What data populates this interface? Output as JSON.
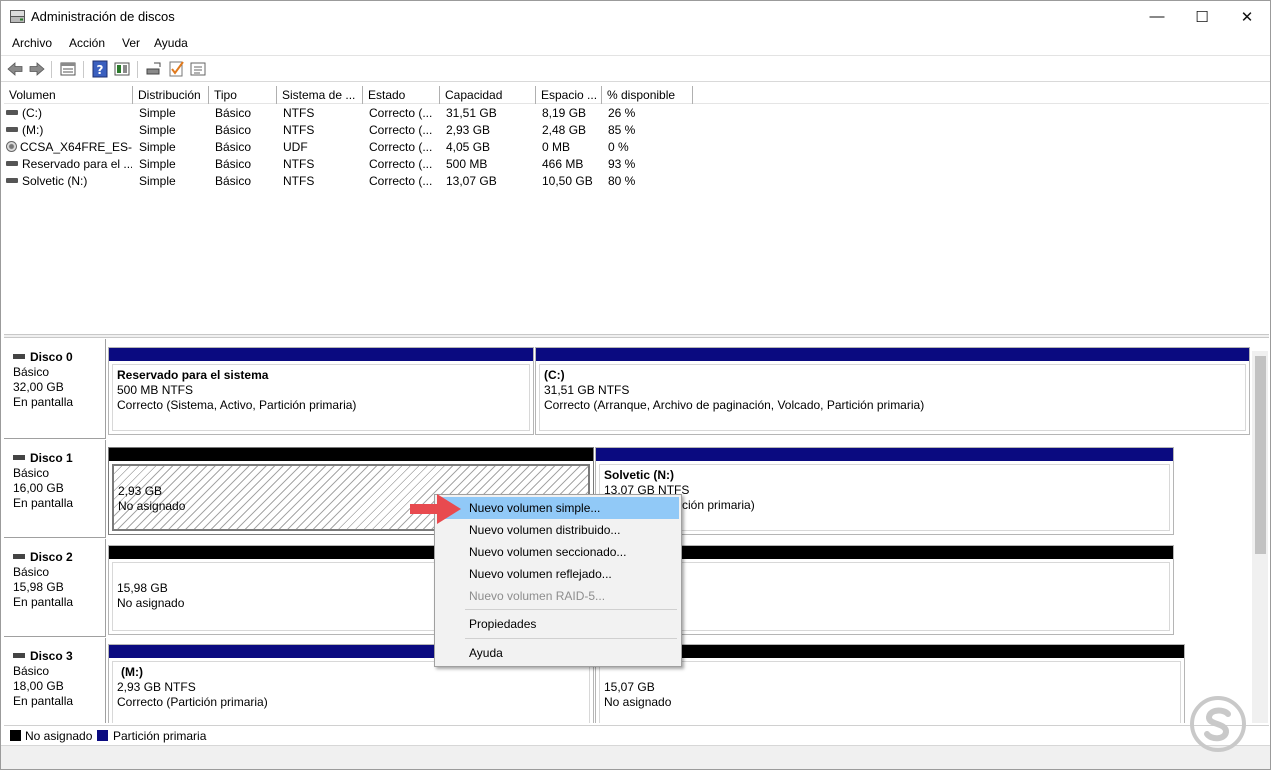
{
  "window": {
    "title": "Administración de discos",
    "minimize": "—",
    "maximize": "☐",
    "close": "✕"
  },
  "menu": [
    "Archivo",
    "Acción",
    "Ver",
    "Ayuda"
  ],
  "toolbar": [
    "back-arrow-icon",
    "forward-arrow-icon",
    "list-view-icon",
    "help-icon",
    "graphic-view-icon",
    "connect-disk-icon",
    "check-icon",
    "properties-icon"
  ],
  "columns": [
    "Volumen",
    "Distribución",
    "Tipo",
    "Sistema de ...",
    "Estado",
    "Capacidad",
    "Espacio ...",
    "% disponible"
  ],
  "volumes": [
    {
      "name": "(C:)",
      "icon": "drive",
      "layout": "Simple",
      "type": "Básico",
      "fs": "NTFS",
      "status": "Correcto (...",
      "capacity": "31,51 GB",
      "free": "8,19 GB",
      "pct": "26 %"
    },
    {
      "name": "(M:)",
      "icon": "drive",
      "layout": "Simple",
      "type": "Básico",
      "fs": "NTFS",
      "status": "Correcto (...",
      "capacity": "2,93 GB",
      "free": "2,48 GB",
      "pct": "85 %"
    },
    {
      "name": "CCSA_X64FRE_ES-...",
      "icon": "cd",
      "layout": "Simple",
      "type": "Básico",
      "fs": "UDF",
      "status": "Correcto (...",
      "capacity": "4,05 GB",
      "free": "0 MB",
      "pct": "0 %"
    },
    {
      "name": "Reservado para el ...",
      "icon": "drive",
      "layout": "Simple",
      "type": "Básico",
      "fs": "NTFS",
      "status": "Correcto (...",
      "capacity": "500 MB",
      "free": "466 MB",
      "pct": "93 %"
    },
    {
      "name": "Solvetic (N:)",
      "icon": "drive",
      "layout": "Simple",
      "type": "Básico",
      "fs": "NTFS",
      "status": "Correcto (...",
      "capacity": "13,07 GB",
      "free": "10,50 GB",
      "pct": "80 %"
    }
  ],
  "disks": [
    {
      "name": "Disco 0",
      "type": "Básico",
      "size": "32,00 GB",
      "state": "En pantalla",
      "partitions": [
        {
          "title": "Reservado para el sistema",
          "line1": "500 MB NTFS",
          "line2": "Correcto (Sistema, Activo, Partición primaria)"
        },
        {
          "title": "(C:)",
          "line1": "31,51 GB NTFS",
          "line2": "Correcto (Arranque, Archivo de paginación, Volcado, Partición primaria)"
        }
      ]
    },
    {
      "name": "Disco 1",
      "type": "Básico",
      "size": "16,00 GB",
      "state": "En pantalla",
      "partitions": [
        {
          "title": "",
          "line1": "2,93 GB",
          "line2": "No asignado"
        },
        {
          "title": "Solvetic  (N:)",
          "line1": "13,07 GB NTFS",
          "line2": "Correcto (Partición primaria)"
        }
      ]
    },
    {
      "name": "Disco 2",
      "type": "Básico",
      "size": "15,98 GB",
      "state": "En pantalla",
      "partitions": [
        {
          "title": "",
          "line1": "15,98 GB",
          "line2": "No asignado"
        }
      ]
    },
    {
      "name": "Disco 3",
      "type": "Básico",
      "size": "18,00 GB",
      "state": "En pantalla",
      "partitions": [
        {
          "title": "(M:)",
          "line1": "2,93 GB NTFS",
          "line2": "Correcto (Partición primaria)"
        },
        {
          "title": "",
          "line1": "15,07 GB",
          "line2": "No asignado"
        }
      ]
    }
  ],
  "context_menu": {
    "items": [
      {
        "label": "Nuevo volumen simple...",
        "state": "highlighted"
      },
      {
        "label": "Nuevo volumen distribuido...",
        "state": "normal"
      },
      {
        "label": "Nuevo volumen seccionado...",
        "state": "normal"
      },
      {
        "label": "Nuevo volumen reflejado...",
        "state": "normal"
      },
      {
        "label": "Nuevo volumen RAID-5...",
        "state": "disabled"
      },
      {
        "label": "Propiedades",
        "state": "normal"
      },
      {
        "label": "Ayuda",
        "state": "normal"
      }
    ]
  },
  "legend": [
    {
      "label": "No asignado",
      "color": "#000000"
    },
    {
      "label": "Partición primaria",
      "color": "#0a0a80"
    }
  ],
  "colors": {
    "primary_partition": "#0a0a80",
    "unallocated": "#000000",
    "menu_highlight": "#91c9f7",
    "arrow": "#e84a4f"
  }
}
